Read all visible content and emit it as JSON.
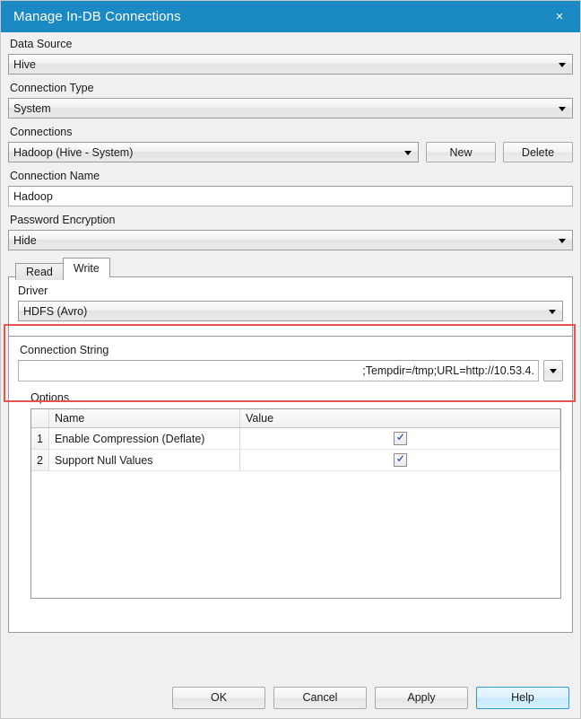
{
  "window": {
    "title": "Manage In-DB Connections",
    "close_label": "×"
  },
  "form": {
    "data_source": {
      "label": "Data Source",
      "value": "Hive"
    },
    "connection_type": {
      "label": "Connection Type",
      "value": "System"
    },
    "connections": {
      "label": "Connections",
      "value": "Hadoop (Hive - System)",
      "new_label": "New",
      "delete_label": "Delete"
    },
    "connection_name": {
      "label": "Connection Name",
      "value": "Hadoop"
    },
    "password_encryption": {
      "label": "Password Encryption",
      "value": "Hide"
    }
  },
  "tabs": [
    {
      "label": "Read",
      "active": false
    },
    {
      "label": "Write",
      "active": true
    }
  ],
  "write_tab": {
    "driver": {
      "label": "Driver",
      "value": "HDFS (Avro)"
    }
  },
  "connection_string": {
    "label": "Connection String",
    "value": ";Tempdir=/tmp;URL=http://10.53.4."
  },
  "options": {
    "label": "Options",
    "columns": [
      "",
      "Name",
      "Value"
    ],
    "rows": [
      {
        "index": "1",
        "name": "Enable Compression (Deflate)",
        "checked": true
      },
      {
        "index": "2",
        "name": "Support Null Values",
        "checked": true
      }
    ]
  },
  "footer": {
    "ok": "OK",
    "cancel": "Cancel",
    "apply": "Apply",
    "help": "Help"
  },
  "colors": {
    "titlebar": "#1b8ac4",
    "highlight": "#e8524f",
    "default_button_border": "#2c9ad6",
    "checkmark": "#21519e"
  }
}
